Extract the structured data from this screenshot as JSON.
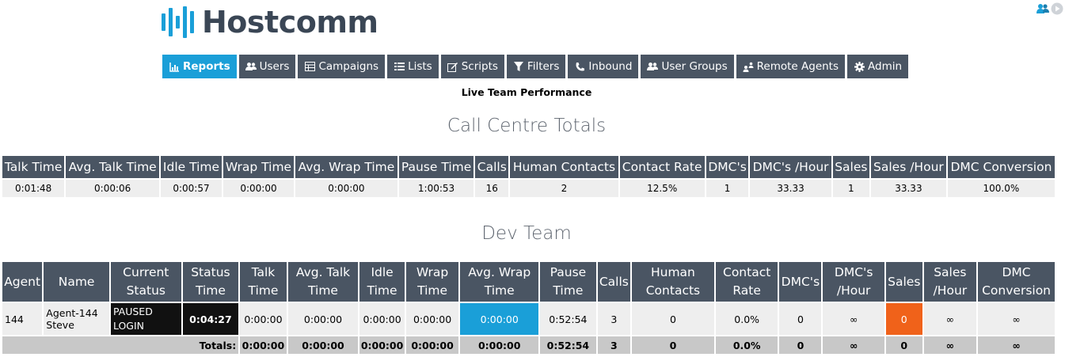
{
  "brand": {
    "name": "Hostcomm",
    "accent": "#1a9fd8",
    "nav_bg": "#4a5563"
  },
  "top_icons": [
    "users-icon",
    "play-circle-icon"
  ],
  "nav": [
    {
      "label": "Reports",
      "icon": "chart-icon",
      "active": true
    },
    {
      "label": "Users",
      "icon": "users-icon"
    },
    {
      "label": "Campaigns",
      "icon": "table-icon"
    },
    {
      "label": "Lists",
      "icon": "list-icon"
    },
    {
      "label": "Scripts",
      "icon": "edit-icon"
    },
    {
      "label": "Filters",
      "icon": "filter-icon"
    },
    {
      "label": "Inbound",
      "icon": "phone-icon"
    },
    {
      "label": "User Groups",
      "icon": "users-icon"
    },
    {
      "label": "Remote Agents",
      "icon": "remote-agents-icon"
    },
    {
      "label": "Admin",
      "icon": "gear-icon"
    }
  ],
  "page_subtitle": "Live Team Performance",
  "totals_section": {
    "title": "Call Centre Totals",
    "headers": [
      "Talk Time",
      "Avg. Talk Time",
      "Idle Time",
      "Wrap Time",
      "Avg. Wrap Time",
      "Pause Time",
      "Calls",
      "Human Contacts",
      "Contact Rate",
      "DMC's",
      "DMC's /Hour",
      "Sales",
      "Sales /Hour",
      "DMC Conversion"
    ],
    "values": [
      "0:01:48",
      "0:00:06",
      "0:00:57",
      "0:00:00",
      "0:00:00",
      "1:00:53",
      "16",
      "2",
      "12.5%",
      "1",
      "33.33",
      "1",
      "33.33",
      "100.0%"
    ]
  },
  "team_section": {
    "title": "Dev Team",
    "headers": [
      "Agent",
      "Name",
      "Current Status",
      "Status Time",
      "Talk Time",
      "Avg. Talk Time",
      "Idle Time",
      "Wrap Time",
      "Avg. Wrap Time",
      "Pause Time",
      "Calls",
      "Human Contacts",
      "Contact Rate",
      "DMC's",
      "DMC's /Hour",
      "Sales",
      "Sales /Hour",
      "DMC Conversion"
    ],
    "row": {
      "agent": "144",
      "name_line1": "Agent-144",
      "name_line2": "Steve",
      "status_line1": "PAUSED",
      "status_line2": "LOGIN",
      "status_time": "0:04:27",
      "talk_time": "0:00:00",
      "avg_talk_time": "0:00:00",
      "idle_time": "0:00:00",
      "wrap_time": "0:00:00",
      "avg_wrap_time": "0:00:00",
      "pause_time": "0:52:54",
      "calls": "3",
      "human_contacts": "0",
      "contact_rate": "0.0%",
      "dmcs": "0",
      "dmcs_hour": "∞",
      "sales": "0",
      "sales_hour": "∞",
      "dmc_conversion": "∞"
    },
    "totals": {
      "label": "Totals:",
      "talk_time": "0:00:00",
      "avg_talk_time": "0:00:00",
      "idle_time": "0:00:00",
      "wrap_time": "0:00:00",
      "avg_wrap_time": "0:00:00",
      "pause_time": "0:52:54",
      "calls": "3",
      "human_contacts": "0",
      "contact_rate": "0.0%",
      "dmcs": "0",
      "dmcs_hour": "∞",
      "sales": "0",
      "sales_hour": "∞",
      "dmc_conversion": "∞"
    }
  }
}
